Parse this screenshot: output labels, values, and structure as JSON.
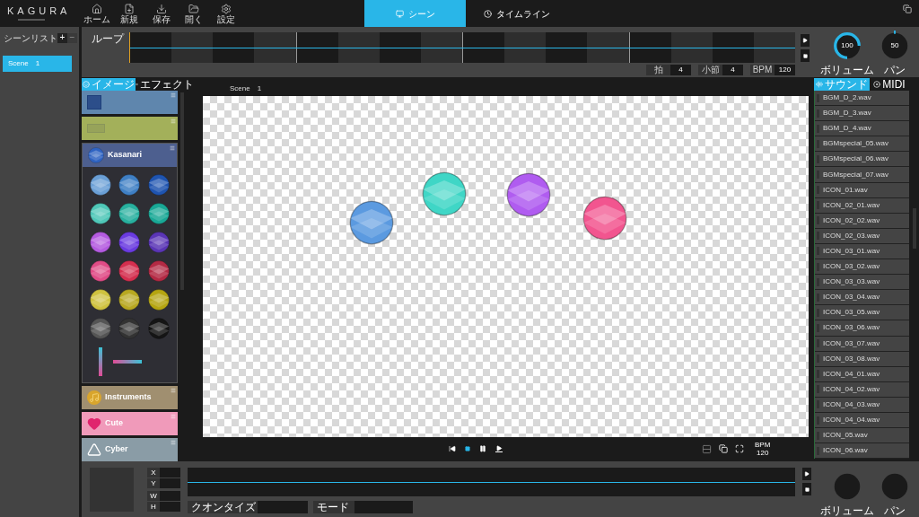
{
  "app": {
    "logo": "KAGURA"
  },
  "toolbar": [
    {
      "kind": "home",
      "label": "ホーム"
    },
    {
      "kind": "new",
      "label": "新規"
    },
    {
      "kind": "save",
      "label": "保存"
    },
    {
      "kind": "open",
      "label": "開く"
    },
    {
      "kind": "settings",
      "label": "設定"
    }
  ],
  "mode_tabs": [
    {
      "kind": "scene",
      "label": "シーン",
      "selected": true
    },
    {
      "kind": "timeline",
      "label": "タイムライン",
      "selected": false
    }
  ],
  "scene_list": {
    "title": "シーンリスト",
    "add": "+",
    "remove": "−",
    "items": [
      {
        "label": "Scene　1",
        "selected": true
      }
    ]
  },
  "loop": {
    "label": "ループ",
    "fields": [
      {
        "label": "拍",
        "value": "4"
      },
      {
        "label": "小節",
        "value": "4"
      },
      {
        "label": "BPM",
        "value": "120"
      }
    ]
  },
  "knobs": [
    {
      "label": "ボリューム",
      "value": "100"
    },
    {
      "label": "パン",
      "value": "50"
    }
  ],
  "palette_tabs": [
    {
      "kind": "image",
      "label": "イメージ",
      "selected": true
    },
    {
      "kind": "effect",
      "label": "エフェクト",
      "selected": false
    }
  ],
  "categories": [
    {
      "kind": "plain",
      "color": "#5f86ad"
    },
    {
      "kind": "plain",
      "color": "#a3b05a"
    },
    {
      "kind": "open",
      "label": "Kasanari",
      "color": "#4d5f8f",
      "swatches": [
        {
          "color": "#6a9fd6"
        },
        {
          "color": "#3f7fc4"
        },
        {
          "color": "#1f54b0"
        },
        {
          "color": "#4fc7b8"
        },
        {
          "color": "#28b09f"
        },
        {
          "color": "#19a896"
        },
        {
          "color": "#b45be0"
        },
        {
          "color": "#6a3be0"
        },
        {
          "color": "#5a35b5"
        },
        {
          "color": "#e04c86"
        },
        {
          "color": "#d42f4f"
        },
        {
          "color": "#b32a44"
        },
        {
          "color": "#cfc23f"
        },
        {
          "color": "#b8a821"
        },
        {
          "color": "#b5a511"
        },
        {
          "color": "#555555"
        },
        {
          "color": "#333333"
        },
        {
          "color": "#151515"
        }
      ]
    },
    {
      "kind": "plain",
      "label": "Instruments",
      "color": "#a08f70"
    },
    {
      "kind": "plain",
      "label": "Cute",
      "color": "#f09aba"
    },
    {
      "kind": "plain",
      "label": "Cyber",
      "color": "#8a9ca6"
    }
  ],
  "canvas": {
    "title": "Scene　1",
    "objects": [
      {
        "color": "#5b9ae0"
      },
      {
        "color": "#3fd6c6"
      },
      {
        "color": "#b05cf0"
      },
      {
        "color": "#f2558f"
      }
    ],
    "bpm_label": "BPM",
    "bpm": "120"
  },
  "sound_tabs": [
    {
      "kind": "sound",
      "label": "サウンド",
      "selected": true
    },
    {
      "kind": "midi",
      "label": "MIDI",
      "selected": false
    }
  ],
  "sounds": [
    "BGM_D_2.wav",
    "BGM_D_3.wav",
    "BGM_D_4.wav",
    "BGMspecial_05.wav",
    "BGMspecial_06.wav",
    "BGMspecial_07.wav",
    "ICON_01.wav",
    "ICON_02_01.wav",
    "ICON_02_02.wav",
    "ICON_02_03.wav",
    "ICON_03_01.wav",
    "ICON_03_02.wav",
    "ICON_03_03.wav",
    "ICON_03_04.wav",
    "ICON_03_05.wav",
    "ICON_03_06.wav",
    "ICON_03_07.wav",
    "ICON_03_08.wav",
    "ICON_04_01.wav",
    "ICON_04_02.wav",
    "ICON_04_03.wav",
    "ICON_04_04.wav",
    "ICON_05.wav",
    "ICON_06.wav"
  ],
  "inspector": {
    "fields": [
      "X",
      "Y",
      "W",
      "H"
    ],
    "quantize": "クオンタイズ",
    "mode": "モード",
    "knobs": [
      "ボリューム",
      "パン"
    ]
  }
}
